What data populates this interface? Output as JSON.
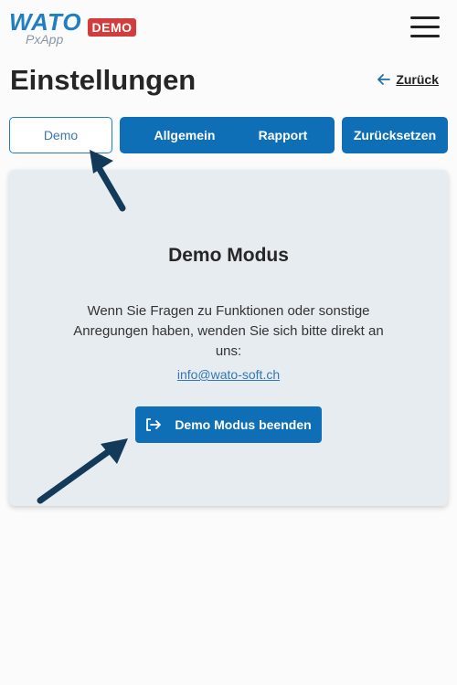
{
  "header": {
    "logo_primary": "WATO",
    "logo_secondary": "PxApp",
    "badge": "DEMO",
    "menu_icon": "hamburger-menu-icon"
  },
  "page": {
    "title": "Einstellungen",
    "back_label": "Zurück",
    "back_icon": "arrow-left-icon"
  },
  "tabs": [
    {
      "label": "Demo",
      "active": true
    },
    {
      "label": "Allgemein",
      "active": false
    },
    {
      "label": "Rapport",
      "active": false
    },
    {
      "label": "Zurücksetzen",
      "active": false
    }
  ],
  "card": {
    "title": "Demo Modus",
    "text": "Wenn Sie Fragen zu Funktionen oder sonstige Anregungen haben, wenden Sie sich bitte direkt an uns:",
    "email": "info@wato-soft.ch",
    "button_label": "Demo Modus beenden",
    "button_icon": "logout-icon"
  },
  "colors": {
    "primary": "#0f6fb6",
    "badge": "#d23c3c",
    "card_bg": "#e7ecf1",
    "annotation_arrow": "#143a5a"
  }
}
